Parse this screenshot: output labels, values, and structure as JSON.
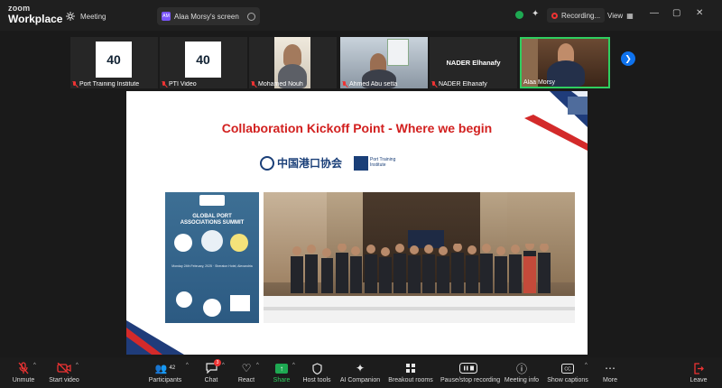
{
  "app": {
    "brand_small": "zoom",
    "brand_large": "Workplace"
  },
  "tabs": [
    {
      "label": "Meeting",
      "icon": "meeting-icon"
    },
    {
      "label": "Alaa Morsy's screen",
      "icon": "screen-share-icon"
    }
  ],
  "header": {
    "recording_label": "Recording...",
    "view_label": "View"
  },
  "thumbnails": [
    {
      "name": "Port Training Institute",
      "muted": true
    },
    {
      "name": "PTI Video",
      "muted": true
    },
    {
      "name": "Mohamed Nouh",
      "muted": true
    },
    {
      "name": "Ahmed Abu setta",
      "muted": true
    },
    {
      "name": "NADER Elhanafy",
      "muted": true,
      "center_text": "NADER Elhanafy"
    },
    {
      "name": "Alaa Morsy",
      "muted": false
    }
  ],
  "logo_text": "40",
  "slide": {
    "title": "Collaboration Kickoff Point - Where we begin",
    "cpha_text": "中国港口协会",
    "pti_text_line1": "Port Training",
    "pti_text_line2": "Institute",
    "poster_title_line1": "GLOBAL PORT",
    "poster_title_line2": "ASSOCIATIONS SUMMIT",
    "poster_date": "Monday 24th February, 2025 · Sheraton Hotel, Alexandria"
  },
  "toolbar": {
    "unmute": "Unmute",
    "start_video": "Start video",
    "participants": "Participants",
    "participants_count": "42",
    "chat": "Chat",
    "chat_badge": "3",
    "react": "React",
    "share": "Share",
    "host_tools": "Host tools",
    "ai_companion": "AI Companion",
    "breakout_rooms": "Breakout rooms",
    "pause_recording": "Pause/stop recording",
    "meeting_info": "Meeting info",
    "show_captions": "Show captions",
    "more": "More",
    "leave": "Leave"
  },
  "colors": {
    "accent": "#0e72ed",
    "green": "#1ea952",
    "red": "#e33333",
    "slide_title": "#d2201f"
  }
}
